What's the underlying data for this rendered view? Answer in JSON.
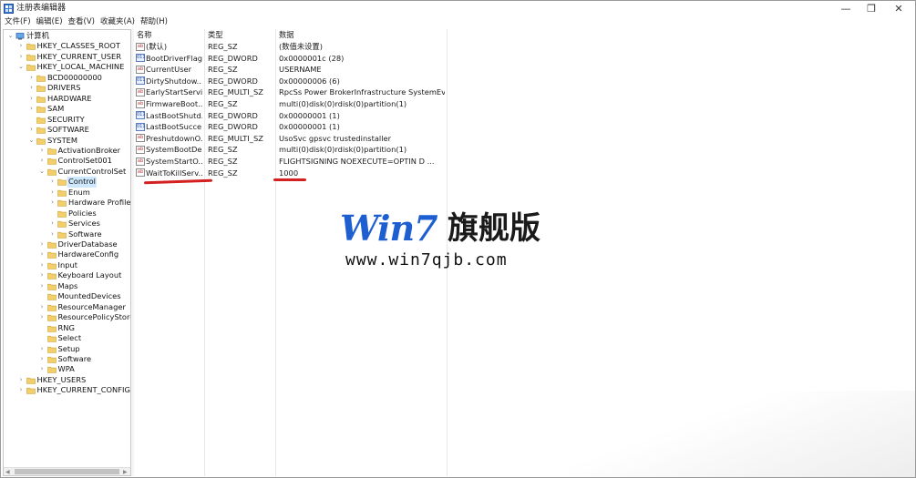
{
  "window": {
    "title": "注册表编辑器",
    "controls": {
      "minimize": "—",
      "maximize": "❐",
      "close": "✕"
    }
  },
  "menu": [
    "文件(F)",
    "编辑(E)",
    "查看(V)",
    "收藏夹(A)",
    "帮助(H)"
  ],
  "tree": [
    {
      "label": "计算机",
      "depth": 0,
      "expander": "v",
      "icon": "computer-icon"
    },
    {
      "label": "HKEY_CLASSES_ROOT",
      "depth": 1,
      "expander": ">",
      "icon": "folder-icon"
    },
    {
      "label": "HKEY_CURRENT_USER",
      "depth": 1,
      "expander": ">",
      "icon": "folder-icon"
    },
    {
      "label": "HKEY_LOCAL_MACHINE",
      "depth": 1,
      "expander": "v",
      "icon": "folder-icon"
    },
    {
      "label": "BCD00000000",
      "depth": 2,
      "expander": ">",
      "icon": "folder-icon"
    },
    {
      "label": "DRIVERS",
      "depth": 2,
      "expander": ">",
      "icon": "folder-icon"
    },
    {
      "label": "HARDWARE",
      "depth": 2,
      "expander": ">",
      "icon": "folder-icon"
    },
    {
      "label": "SAM",
      "depth": 2,
      "expander": ">",
      "icon": "folder-icon"
    },
    {
      "label": "SECURITY",
      "depth": 2,
      "expander": "",
      "icon": "folder-icon"
    },
    {
      "label": "SOFTWARE",
      "depth": 2,
      "expander": ">",
      "icon": "folder-icon"
    },
    {
      "label": "SYSTEM",
      "depth": 2,
      "expander": "v",
      "icon": "folder-icon"
    },
    {
      "label": "ActivationBroker",
      "depth": 3,
      "expander": ">",
      "icon": "folder-icon"
    },
    {
      "label": "ControlSet001",
      "depth": 3,
      "expander": ">",
      "icon": "folder-icon"
    },
    {
      "label": "CurrentControlSet",
      "depth": 3,
      "expander": "v",
      "icon": "folder-icon"
    },
    {
      "label": "Control",
      "depth": 4,
      "expander": ">",
      "icon": "folder-icon",
      "selected": true
    },
    {
      "label": "Enum",
      "depth": 4,
      "expander": ">",
      "icon": "folder-icon"
    },
    {
      "label": "Hardware Profile",
      "depth": 4,
      "expander": ">",
      "icon": "folder-icon"
    },
    {
      "label": "Policies",
      "depth": 4,
      "expander": "",
      "icon": "folder-icon"
    },
    {
      "label": "Services",
      "depth": 4,
      "expander": ">",
      "icon": "folder-icon"
    },
    {
      "label": "Software",
      "depth": 4,
      "expander": ">",
      "icon": "folder-icon"
    },
    {
      "label": "DriverDatabase",
      "depth": 3,
      "expander": ">",
      "icon": "folder-icon"
    },
    {
      "label": "HardwareConfig",
      "depth": 3,
      "expander": ">",
      "icon": "folder-icon"
    },
    {
      "label": "Input",
      "depth": 3,
      "expander": ">",
      "icon": "folder-icon"
    },
    {
      "label": "Keyboard Layout",
      "depth": 3,
      "expander": ">",
      "icon": "folder-icon"
    },
    {
      "label": "Maps",
      "depth": 3,
      "expander": ">",
      "icon": "folder-icon"
    },
    {
      "label": "MountedDevices",
      "depth": 3,
      "expander": "",
      "icon": "folder-icon"
    },
    {
      "label": "ResourceManager",
      "depth": 3,
      "expander": ">",
      "icon": "folder-icon"
    },
    {
      "label": "ResourcePolicyStore",
      "depth": 3,
      "expander": ">",
      "icon": "folder-icon"
    },
    {
      "label": "RNG",
      "depth": 3,
      "expander": "",
      "icon": "folder-icon"
    },
    {
      "label": "Select",
      "depth": 3,
      "expander": "",
      "icon": "folder-icon"
    },
    {
      "label": "Setup",
      "depth": 3,
      "expander": ">",
      "icon": "folder-icon"
    },
    {
      "label": "Software",
      "depth": 3,
      "expander": ">",
      "icon": "folder-icon"
    },
    {
      "label": "WPA",
      "depth": 3,
      "expander": ">",
      "icon": "folder-icon"
    },
    {
      "label": "HKEY_USERS",
      "depth": 1,
      "expander": ">",
      "icon": "folder-icon"
    },
    {
      "label": "HKEY_CURRENT_CONFIG",
      "depth": 1,
      "expander": ">",
      "icon": "folder-icon"
    }
  ],
  "columns": {
    "name": "名称",
    "type": "类型",
    "data": "数据"
  },
  "values": [
    {
      "name": "(默认)",
      "type": "REG_SZ",
      "data": "(数值未设置)",
      "kind": "sz"
    },
    {
      "name": "BootDriverFlags",
      "type": "REG_DWORD",
      "data": "0x0000001c (28)",
      "kind": "dw"
    },
    {
      "name": "CurrentUser",
      "type": "REG_SZ",
      "data": "USERNAME",
      "kind": "sz"
    },
    {
      "name": "DirtyShutdow...",
      "type": "REG_DWORD",
      "data": "0x00000006 (6)",
      "kind": "dw"
    },
    {
      "name": "EarlyStartServi...",
      "type": "REG_MULTI_SZ",
      "data": "RpcSs Power BrokerInfrastructure SystemEve...",
      "kind": "sz"
    },
    {
      "name": "FirmwareBoot...",
      "type": "REG_SZ",
      "data": "multi(0)disk(0)rdisk(0)partition(1)",
      "kind": "sz"
    },
    {
      "name": "LastBootShutd...",
      "type": "REG_DWORD",
      "data": "0x00000001 (1)",
      "kind": "dw"
    },
    {
      "name": "LastBootSucce...",
      "type": "REG_DWORD",
      "data": "0x00000001 (1)",
      "kind": "dw"
    },
    {
      "name": "PreshutdownO...",
      "type": "REG_MULTI_SZ",
      "data": "UsoSvc gpsvc trustedinstaller",
      "kind": "sz"
    },
    {
      "name": "SystemBootDe...",
      "type": "REG_SZ",
      "data": "multi(0)disk(0)rdisk(0)partition(1)",
      "kind": "sz"
    },
    {
      "name": "SystemStartO...",
      "type": "REG_SZ",
      "data": " FLIGHTSIGNING  NOEXECUTE=OPTIN D      ...",
      "kind": "sz"
    },
    {
      "name": "WaitToKillServ...",
      "type": "REG_SZ",
      "data": "1000",
      "kind": "sz"
    }
  ],
  "icon_labels": {
    "sz": "ab",
    "dw": "011"
  },
  "watermark": {
    "main": "Win7",
    "cn": "旗舰版",
    "url": "www.win7qjb.com"
  },
  "colors": {
    "annotation": "#d42020",
    "watermark_blue": "#1d5fd0",
    "selection": "#cde8ff"
  }
}
